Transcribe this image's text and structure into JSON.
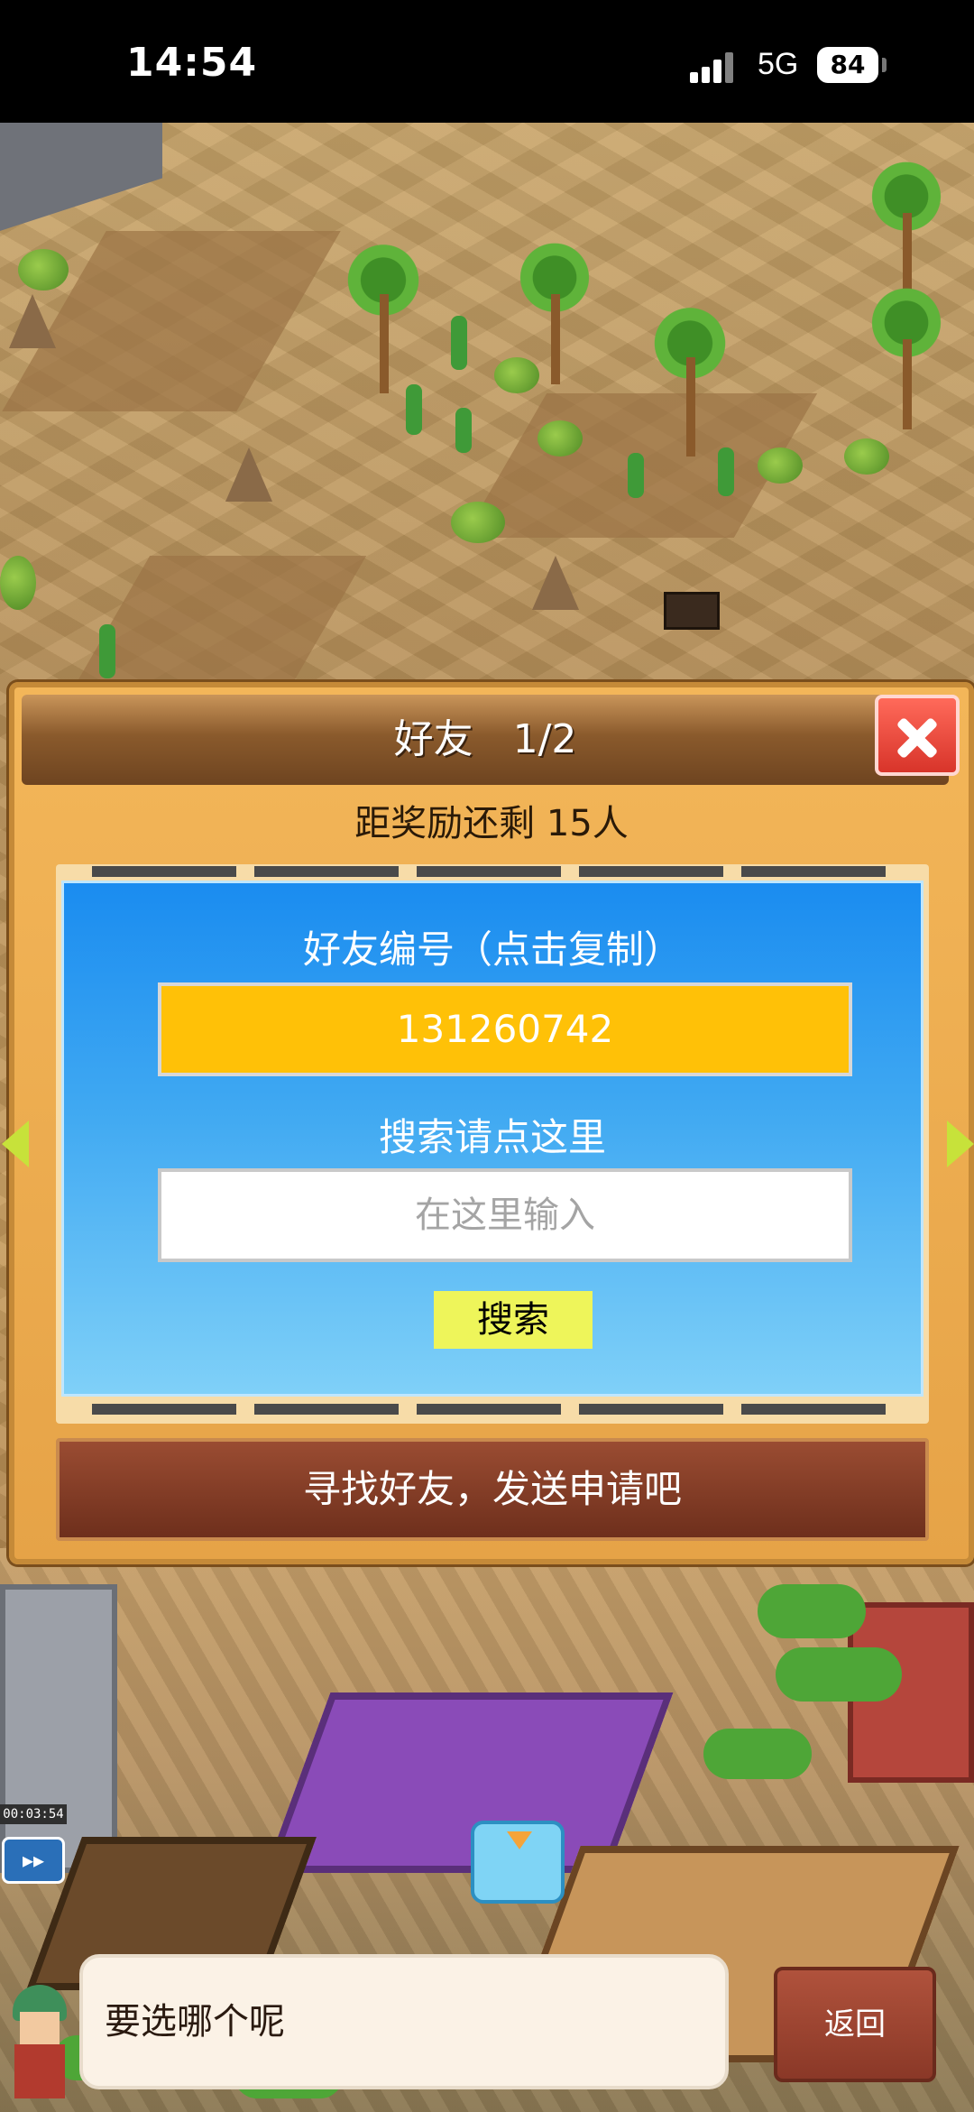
{
  "status_bar": {
    "time": "14:54",
    "network": "5G",
    "battery": "84"
  },
  "dialog": {
    "title": "好友　1/2",
    "reward_text": "距奖励还剩 15人",
    "friend_code_label": "好友编号（点击复制）",
    "friend_code": "131260742",
    "search_label": "搜索请点这里",
    "search_placeholder": "在这里输入",
    "search_button": "搜索",
    "find_friends_button": "寻找好友，发送申请吧"
  },
  "bottom": {
    "message": "要选哪个呢",
    "back_button": "返回"
  },
  "colors": {
    "panel": "#f3b659",
    "panel_header": "#8a5a2c",
    "friend_code_bg": "#ffc107",
    "search_button_bg": "#eef55a",
    "close_button": "#e84a3c",
    "blue_box": "#1a8cf0",
    "find_bar": "#7e3a24"
  },
  "icons": {
    "close": "close-x-icon",
    "prev": "arrow-left-icon",
    "next": "arrow-right-icon",
    "speed": "fast-forward-icon"
  }
}
